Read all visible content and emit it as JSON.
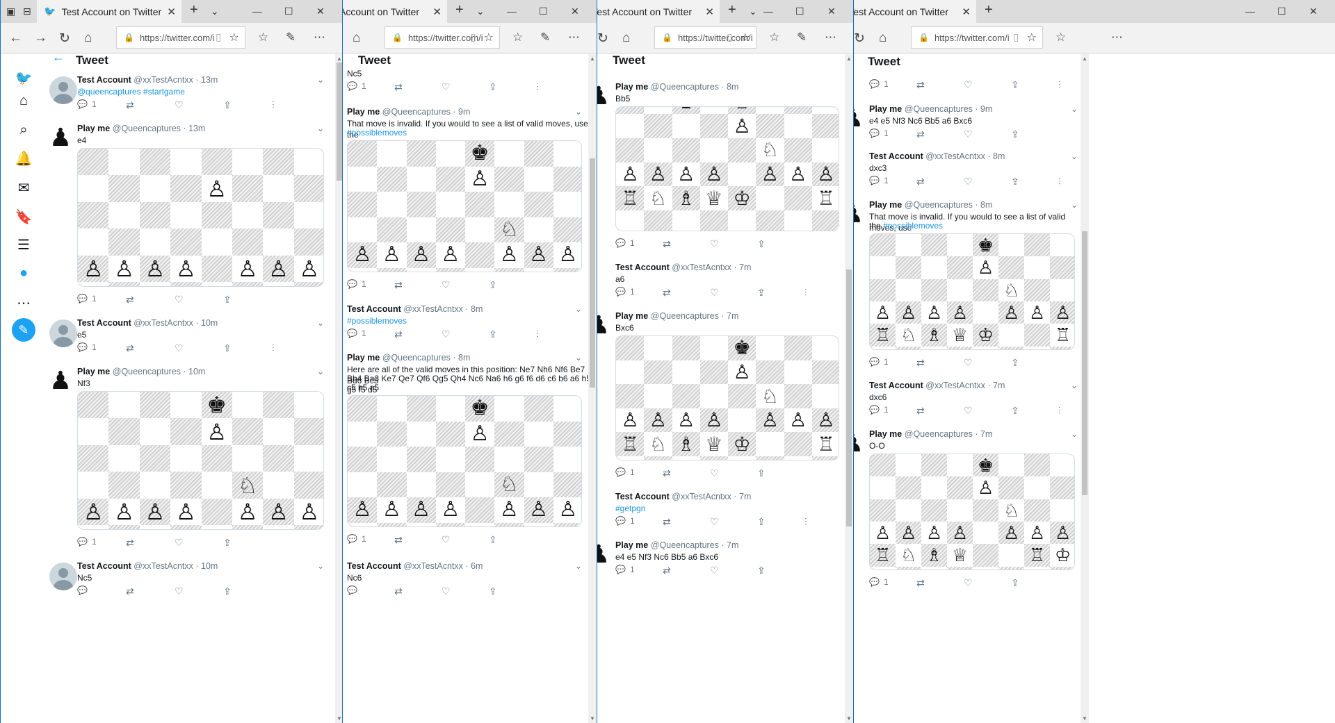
{
  "windows": [
    {
      "tab_title": "Test Account on Twitter",
      "url": "https://twitter.com/i",
      "header_title": "Tweet",
      "tweets": [
        {
          "kind": "acct",
          "name": "Test Account",
          "handle": "@xxTestAcntxx · 13m",
          "lines": [
            {
              "seg": [
                {
                  "t": "@queencaptures #startgame",
                  "link": true
                }
              ]
            }
          ],
          "reply": "1",
          "analytics": true
        },
        {
          "kind": "bot",
          "name": "Play me",
          "handle": "@Queencaptures · 13m",
          "lines": [
            {
              "seg": [
                {
                  "t": "e4"
                }
              ]
            }
          ],
          "board": "b1",
          "reply": "1",
          "analytics": false
        },
        {
          "kind": "acct",
          "name": "Test Account",
          "handle": "@xxTestAcntxx · 10m",
          "lines": [
            {
              "seg": [
                {
                  "t": "e5"
                }
              ]
            }
          ],
          "reply": "1",
          "analytics": true
        },
        {
          "kind": "bot",
          "name": "Play me",
          "handle": "@Queencaptures · 10m",
          "lines": [
            {
              "seg": [
                {
                  "t": "Nf3"
                }
              ]
            }
          ],
          "board": "b2",
          "reply": "1",
          "analytics": false
        },
        {
          "kind": "acct",
          "name": "Test Account",
          "handle": "@xxTestAcntxx · 10m",
          "lines": [
            {
              "seg": [
                {
                  "t": "Nc5"
                }
              ]
            }
          ],
          "reply": "",
          "analytics": false
        }
      ]
    },
    {
      "tab_title": "Test Account on Twitter",
      "url": "https://twitter.com/i",
      "header_title": "Tweet",
      "tweets": [
        {
          "kind": "none",
          "lines": [
            {
              "seg": [
                {
                  "t": "Nc5"
                }
              ]
            }
          ],
          "reply": "1",
          "analytics": true
        },
        {
          "kind": "bot",
          "name": "Play me",
          "handle": "@Queencaptures · 9m",
          "lines": [
            {
              "seg": [
                {
                  "t": "That move is invalid. If you would to see a list of valid moves, use the"
                }
              ]
            },
            {
              "seg": [
                {
                  "t": "#possiblemoves",
                  "link": true
                }
              ]
            }
          ],
          "board": "b2",
          "reply": "1",
          "analytics": false
        },
        {
          "kind": "acct",
          "name": "Test Account",
          "handle": "@xxTestAcntxx · 8m",
          "lines": [
            {
              "seg": [
                {
                  "t": "#possiblemoves",
                  "link": true
                }
              ]
            }
          ],
          "reply": "1",
          "analytics": true
        },
        {
          "kind": "bot",
          "name": "Play me",
          "handle": "@Queencaptures · 8m",
          "lines": [
            {
              "seg": [
                {
                  "t": "Here are all of the valid moves in this position: Ne7 Nh6 Nf6 Be7 Bd6 Bc5"
                }
              ]
            },
            {
              "seg": [
                {
                  "t": "Bb4 Ba3 Ke7 Qe7 Qf6 Qg5 Qh4 Nc6 Na6 h6 g6 f6 d6 c6 b6 a6 h5 g5 f5 d5"
                }
              ]
            },
            {
              "seg": [
                {
                  "t": "c5 b5 a5"
                }
              ]
            }
          ],
          "board": "b2",
          "reply": "1",
          "analytics": false
        },
        {
          "kind": "acct",
          "name": "Test Account",
          "handle": "@xxTestAcntxx · 6m",
          "lines": [
            {
              "seg": [
                {
                  "t": "Nc6"
                }
              ]
            }
          ],
          "reply": "",
          "analytics": false
        }
      ]
    },
    {
      "tab_title": "Test Account on Twitter",
      "url": "https://twitter.com/i",
      "header_title": "Tweet",
      "tweets": [
        {
          "kind": "bot",
          "name": "Play me",
          "handle": "@Queencaptures · 8m",
          "lines": [
            {
              "seg": [
                {
                  "t": "Bb5"
                }
              ]
            }
          ],
          "board": "b3",
          "reply": "1",
          "analytics": false
        },
        {
          "kind": "acct",
          "name": "Test Account",
          "handle": "@xxTestAcntxx · 7m",
          "lines": [
            {
              "seg": [
                {
                  "t": "a6"
                }
              ]
            }
          ],
          "reply": "1",
          "analytics": true
        },
        {
          "kind": "bot",
          "name": "Play me",
          "handle": "@Queencaptures · 7m",
          "lines": [
            {
              "seg": [
                {
                  "t": "Bxc6"
                }
              ]
            }
          ],
          "board": "b4",
          "reply": "1",
          "analytics": false
        },
        {
          "kind": "acct",
          "name": "Test Account",
          "handle": "@xxTestAcntxx · 7m",
          "lines": [
            {
              "seg": [
                {
                  "t": "#getpgn",
                  "link": true
                }
              ]
            }
          ],
          "reply": "1",
          "analytics": true
        },
        {
          "kind": "bot",
          "name": "Play me",
          "handle": "@Queencaptures · 7m",
          "lines": [
            {
              "seg": [
                {
                  "t": "e4 e5 Nf3 Nc6 Bb5 a6 Bxc6"
                }
              ]
            }
          ],
          "reply": "1",
          "analytics": false
        }
      ]
    },
    {
      "tab_title": "Test Account on Twitter",
      "url": "https://twitter.com/i",
      "header_title": "Tweet",
      "tweets": [
        {
          "kind": "none",
          "lines": [],
          "reply": "1",
          "analytics": true
        },
        {
          "kind": "bot",
          "name": "Play me",
          "handle": "@Queencaptures · 9m",
          "lines": [
            {
              "seg": [
                {
                  "t": "e4 e5 Nf3 Nc6 Bb5 a6 Bxc6"
                }
              ]
            }
          ],
          "reply": "1",
          "analytics": false
        },
        {
          "kind": "acct",
          "name": "Test Account",
          "handle": "@xxTestAcntxx · 8m",
          "lines": [
            {
              "seg": [
                {
                  "t": "dxc3"
                }
              ]
            }
          ],
          "reply": "1",
          "analytics": true
        },
        {
          "kind": "bot",
          "name": "Play me",
          "handle": "@Queencaptures · 8m",
          "lines": [
            {
              "seg": [
                {
                  "t": "That move is invalid. If you would to see a list of valid moves, use"
                }
              ]
            },
            {
              "seg": [
                {
                  "t": "the "
                },
                {
                  "t": "#possiblemoves",
                  "link": true
                }
              ]
            }
          ],
          "board": "b4",
          "reply": "1",
          "analytics": false
        },
        {
          "kind": "acct",
          "name": "Test Account",
          "handle": "@xxTestAcntxx · 7m",
          "lines": [
            {
              "seg": [
                {
                  "t": "dxc6"
                }
              ]
            }
          ],
          "reply": "1",
          "analytics": true
        },
        {
          "kind": "bot",
          "name": "Play me",
          "handle": "@Queencaptures · 7m",
          "lines": [
            {
              "seg": [
                {
                  "t": "O-O"
                }
              ]
            }
          ],
          "board": "b5",
          "reply": "1",
          "analytics": false
        }
      ]
    }
  ],
  "boards": {
    "b1": [
      "........",
      "....p...",
      "........",
      "........",
      "pppp.ppp",
      "........",
      "........",
      "........"
    ],
    "b2": [
      "....k...",
      "....p...",
      "........",
      ".....n..",
      "pppp.ppp",
      "rnbqkb.r",
      "........",
      "........"
    ],
    "b3": [
      "..b.k...",
      "....p...",
      ".....n..",
      "pppp.ppp",
      "rnbqk..r",
      "........",
      "........",
      "........"
    ],
    "b4": [
      "....k...",
      "....p...",
      ".....n..",
      "pppp.ppp",
      "rnbqk..r",
      "........",
      "........",
      "........"
    ],
    "b5": [
      "....k...",
      "....p...",
      ".....n..",
      "pppp.ppp",
      "rnbq..rk",
      "........",
      "........",
      "........"
    ]
  },
  "icons": {
    "reply": "reply-icon",
    "retweet": "retweet-icon",
    "like": "like-icon",
    "share": "share-icon",
    "analytics": "analytics-icon"
  },
  "accent": "#1da1f2"
}
